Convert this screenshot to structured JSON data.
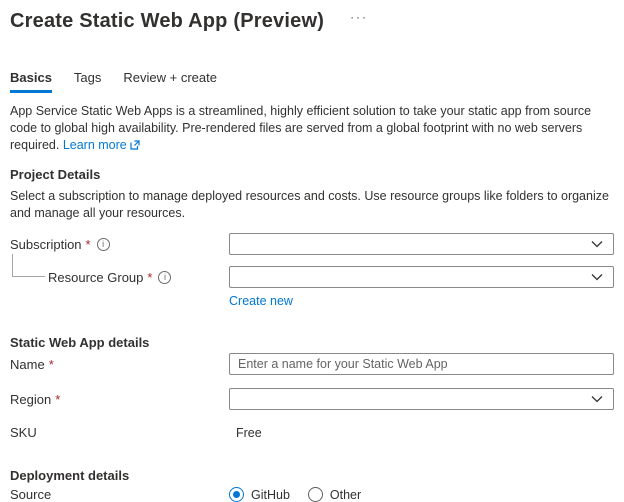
{
  "page": {
    "title": "Create Static Web App (Preview)"
  },
  "icons": {
    "more_options": "···",
    "info": "i",
    "chevron_down": "chevron-down",
    "external_link": "external-link"
  },
  "common": {
    "required_marker": "*"
  },
  "tabs": [
    {
      "label": "Basics",
      "active": true
    },
    {
      "label": "Tags",
      "active": false
    },
    {
      "label": "Review + create",
      "active": false
    }
  ],
  "intro": {
    "text": "App Service Static Web Apps is a streamlined, highly efficient solution to take your static app from source code to global high availability. Pre-rendered files are served from a global footprint with no web servers required.",
    "link_label": "Learn more"
  },
  "project_details": {
    "heading": "Project Details",
    "description": "Select a subscription to manage deployed resources and costs. Use resource groups like folders to organize and manage all your resources.",
    "subscription_label": "Subscription",
    "subscription_value": "",
    "resource_group_label": "Resource Group",
    "resource_group_value": "",
    "create_new_label": "Create new"
  },
  "app_details": {
    "heading": "Static Web App details",
    "name_label": "Name",
    "name_value": "",
    "name_placeholder": "Enter a name for your Static Web App",
    "region_label": "Region",
    "region_value": "",
    "sku_label": "SKU",
    "sku_value": "Free"
  },
  "deployment": {
    "heading": "Deployment details",
    "source_label": "Source",
    "options": [
      {
        "label": "GitHub",
        "selected": true
      },
      {
        "label": "Other",
        "selected": false
      }
    ]
  },
  "colors": {
    "accent": "#0078d4",
    "text": "#323130",
    "required": "#a4262c",
    "field_border": "#8a8886",
    "link": "#0078d4"
  }
}
